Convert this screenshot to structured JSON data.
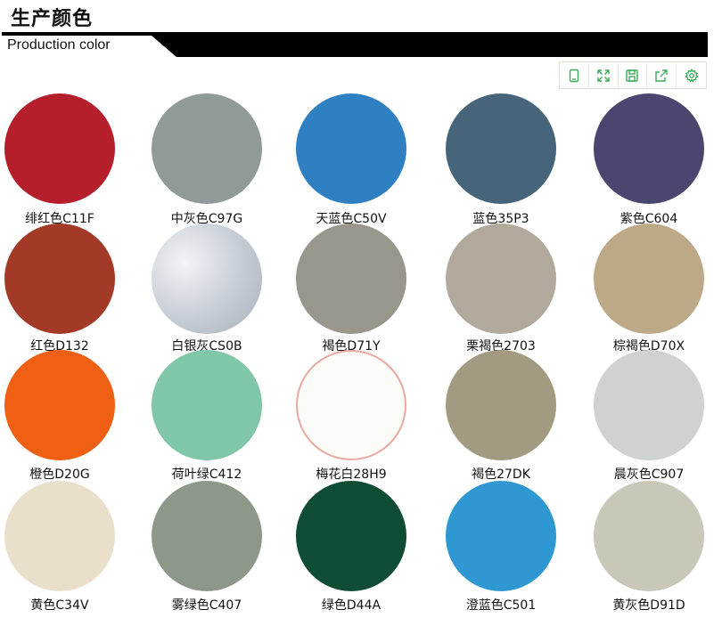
{
  "header": {
    "title": "生产颜色",
    "subtitle": "Production color"
  },
  "toolbar": {
    "buttons": [
      {
        "icon": "tablet-icon"
      },
      {
        "icon": "expand-icon"
      },
      {
        "icon": "save-icon"
      },
      {
        "icon": "share-icon"
      },
      {
        "icon": "settings-icon"
      }
    ],
    "accent_color": "#3bab5a"
  },
  "swatches": [
    {
      "label": "绯红色C11F",
      "color": "#b51e2b"
    },
    {
      "label": "中灰色C97G",
      "color": "#8f9a99"
    },
    {
      "label": "天蓝色C50V",
      "color": "#2f80c2"
    },
    {
      "label": "蓝色35P3",
      "color": "#46657a"
    },
    {
      "label": "紫色C604",
      "color": "#4a4670"
    },
    {
      "label": "红色D132",
      "color": "#a33a27"
    },
    {
      "label": "白银灰CS0B",
      "color": "#c6ccd4"
    },
    {
      "label": "褐色D71Y",
      "color": "#99978b"
    },
    {
      "label": "栗褐色2703",
      "color": "#b1aa9c"
    },
    {
      "label": "棕褐色D70X",
      "color": "#bda988"
    },
    {
      "label": "橙色D20G",
      "color": "#ef5f14"
    },
    {
      "label": "荷叶绿C412",
      "color": "#80c6a8"
    },
    {
      "label": "梅花白28H9",
      "color": "#fbfbf8"
    },
    {
      "label": "褐色27DK",
      "color": "#a29a81"
    },
    {
      "label": "晨灰色C907",
      "color": "#cfd2d1"
    },
    {
      "label": "黄色C34V",
      "color": "#eadfcb"
    },
    {
      "label": "雾绿色C407",
      "color": "#8e9889"
    },
    {
      "label": "绿色D44A",
      "color": "#0e4c33"
    },
    {
      "label": "澄蓝色C501",
      "color": "#2f98d2"
    },
    {
      "label": "黄灰色D91D",
      "color": "#c8c7b8"
    }
  ]
}
